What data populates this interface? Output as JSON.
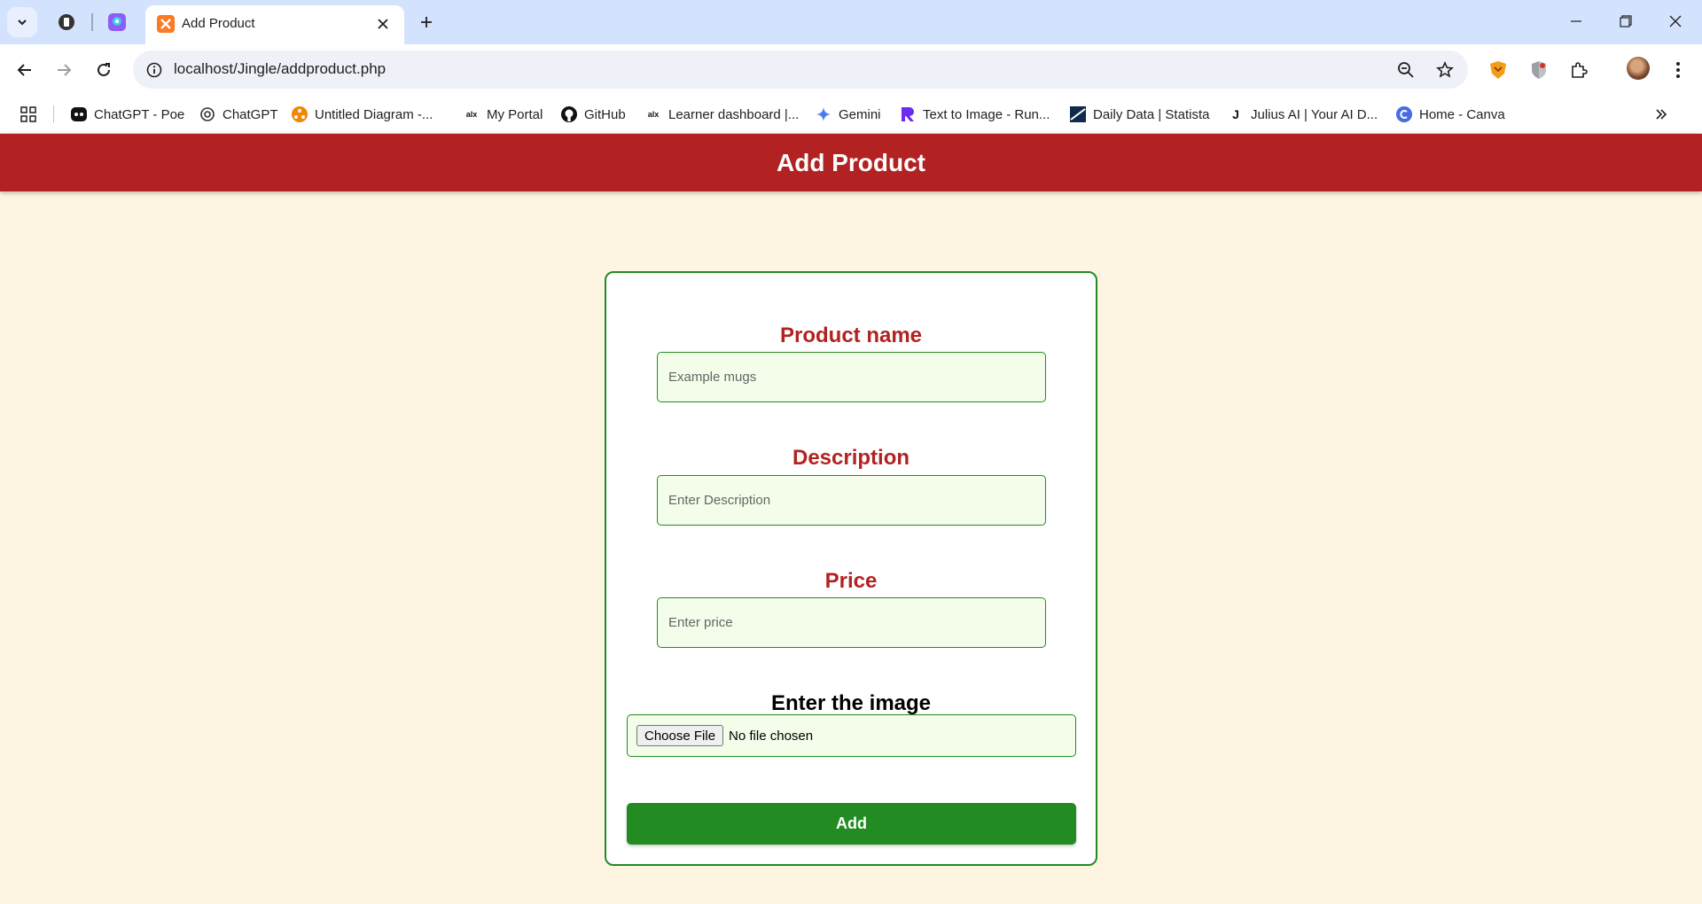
{
  "browser": {
    "active_tab_title": "Add Product",
    "url": "localhost/Jingle/addproduct.php",
    "bookmarks": [
      {
        "label": "ChatGPT - Poe",
        "icon": "poe-icon"
      },
      {
        "label": "ChatGPT",
        "icon": "openai-icon"
      },
      {
        "label": "Untitled Diagram -...",
        "icon": "drawio-icon"
      },
      {
        "label": "My Portal",
        "icon": "alx-icon"
      },
      {
        "label": "GitHub",
        "icon": "github-icon"
      },
      {
        "label": "Learner dashboard |...",
        "icon": "alx-icon"
      },
      {
        "label": "Gemini",
        "icon": "gemini-icon"
      },
      {
        "label": "Text to Image - Run...",
        "icon": "runway-icon"
      },
      {
        "label": "Daily Data | Statista",
        "icon": "statista-icon"
      },
      {
        "label": "Julius AI | Your AI D...",
        "icon": "julius-icon"
      },
      {
        "label": "Home - Canva",
        "icon": "canva-icon"
      }
    ]
  },
  "page": {
    "header_title": "Add Product",
    "form": {
      "product_name_label": "Product name",
      "product_name_placeholder": "Example mugs",
      "description_label": "Description",
      "description_placeholder": "Enter Description",
      "price_label": "Price",
      "price_placeholder": "Enter price",
      "image_label": "Enter the image",
      "file_button_label": "Choose File",
      "file_status": "No file chosen",
      "submit_label": "Add"
    }
  },
  "colors": {
    "header_bg": "#b22222",
    "accent_green": "#228b22",
    "page_bg": "#fdf5e2",
    "input_bg": "#f3fde9"
  }
}
